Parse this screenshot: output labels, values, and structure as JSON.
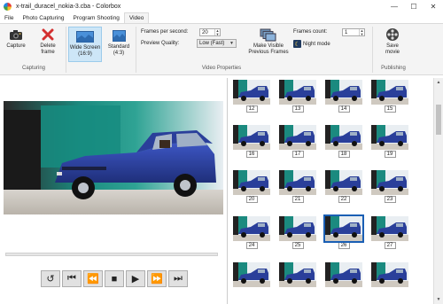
{
  "window": {
    "title": "x-trail_duracel_nokia-3.cba - Colorbox",
    "minimize_glyph": "—",
    "maximize_glyph": "☐",
    "close_glyph": "✕"
  },
  "tabs": [
    {
      "label": "File",
      "active": false
    },
    {
      "label": "Photo Capturing",
      "active": false
    },
    {
      "label": "Program Shooting",
      "active": false
    },
    {
      "label": "Video",
      "active": true
    }
  ],
  "ribbon": {
    "capturing": {
      "group_label": "Capturing",
      "capture_label": "Capture",
      "delete_label": "Delete\nframe"
    },
    "aspect": {
      "wide_label": "Wide Screen\n(16:9)",
      "standard_label": "Standard\n(4:3)"
    },
    "video_properties": {
      "group_label": "Video Properties",
      "fps_label": "Frames per second:",
      "fps_value": "20",
      "quality_label": "Preview Quality:",
      "quality_value": "Low (Fast)",
      "make_visible_label": "Make Visible\nPrevious Frames",
      "frames_count_label": "Frames count:",
      "frames_count_value": "1",
      "night_mode_label": "Night mode"
    },
    "publishing": {
      "group_label": "Publishing",
      "save_movie_label": "Save\nmovie"
    }
  },
  "player": {
    "rewind_icon": "↺",
    "first_icon": "⏮",
    "prev_icon": "⏪",
    "stop_icon": "■",
    "play_icon": "▶",
    "next_icon": "⏩",
    "last_icon": "⏭"
  },
  "frames": [
    {
      "number": "12"
    },
    {
      "number": "13"
    },
    {
      "number": "14"
    },
    {
      "number": "15"
    },
    {
      "number": "16"
    },
    {
      "number": "17"
    },
    {
      "number": "18"
    },
    {
      "number": "19"
    },
    {
      "number": "20"
    },
    {
      "number": "21"
    },
    {
      "number": "22"
    },
    {
      "number": "23"
    },
    {
      "number": "24"
    },
    {
      "number": "25"
    },
    {
      "number": "26"
    },
    {
      "number": "27"
    },
    {
      "number": ""
    },
    {
      "number": ""
    },
    {
      "number": ""
    },
    {
      "number": ""
    }
  ],
  "selected_frame": "26",
  "colors": {
    "accent": "#1a5fb4",
    "selected_button_bg": "#cde6f7",
    "car_blue": "#2a3f9a",
    "background_teal": "#1f8f86"
  }
}
